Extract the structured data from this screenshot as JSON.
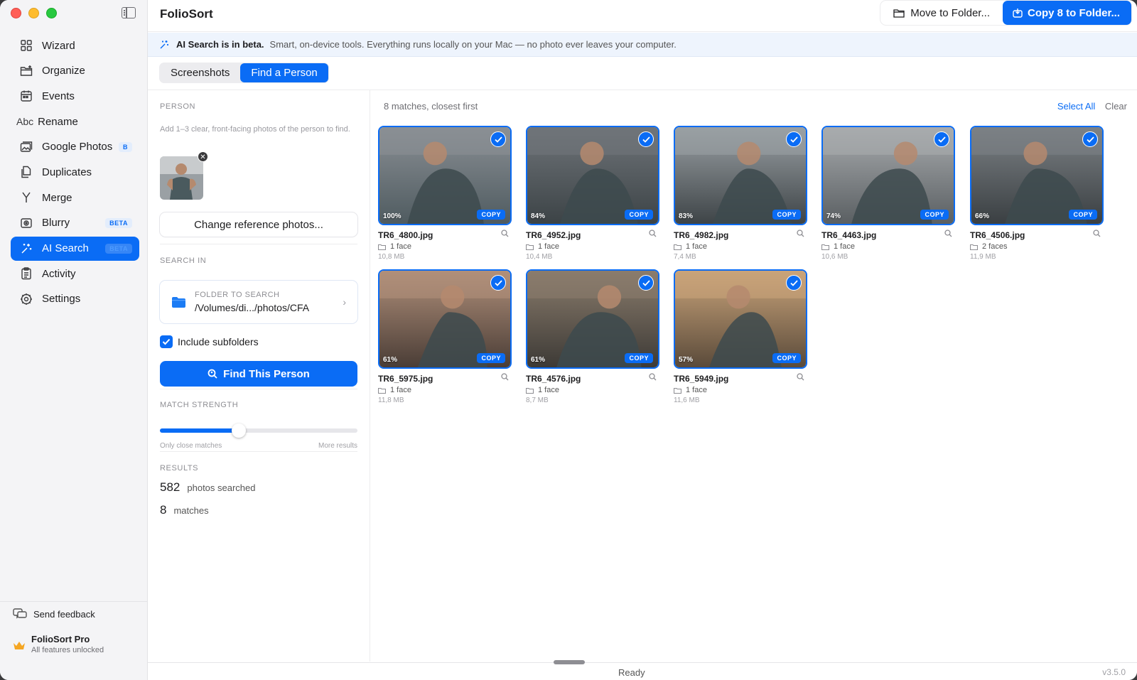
{
  "app": {
    "title": "FolioSort"
  },
  "colors": {
    "accent": "#0a6cf5"
  },
  "sidebar": {
    "items": [
      {
        "label": "Wizard",
        "icon": "grid-icon"
      },
      {
        "label": "Organize",
        "icon": "folder-plus-icon"
      },
      {
        "label": "Events",
        "icon": "calendar-icon"
      },
      {
        "label": "Rename",
        "icon": "abc-text-icon",
        "icon_text": "Abc"
      },
      {
        "label": "Google Photos",
        "icon": "photos-icon",
        "badge": "B"
      },
      {
        "label": "Duplicates",
        "icon": "duplicate-icon"
      },
      {
        "label": "Merge",
        "icon": "merge-icon"
      },
      {
        "label": "Blurry",
        "icon": "blur-icon",
        "badge": "BETA"
      },
      {
        "label": "AI Search",
        "icon": "sparkle-icon",
        "badge": "BETA",
        "active": true
      },
      {
        "label": "Activity",
        "icon": "clipboard-icon"
      },
      {
        "label": "Settings",
        "icon": "gear-icon"
      }
    ],
    "feedback": "Send feedback",
    "pro_title": "FolioSort Pro",
    "pro_sub": "All features unlocked"
  },
  "toolbar": {
    "move_label": "Move to Folder...",
    "copy_label": "Copy 8 to Folder..."
  },
  "banner": {
    "title": "AI Search is in beta.",
    "text": "Smart, on-device tools. Everything runs locally on your Mac — no photo ever leaves your computer."
  },
  "tabs": [
    {
      "label": "Screenshots",
      "active": false
    },
    {
      "label": "Find a Person",
      "active": true
    }
  ],
  "panel": {
    "person_label": "PERSON",
    "person_hint": "Add 1–3 clear, front-facing photos of the person to find.",
    "remove_glyph": "✕",
    "change_label": "Change reference photos...",
    "search_in_label": "SEARCH IN",
    "folder_label": "FOLDER TO SEARCH",
    "folder_path": "/Volumes/di.../photos/CFA",
    "include_subfolders": "Include subfolders",
    "include_subfolders_checked": true,
    "find_label": "Find This Person",
    "match_label": "MATCH STRENGTH",
    "match_value": 0.4,
    "match_left": "Only close matches",
    "match_right": "More results",
    "results_label": "RESULTS",
    "searched_count": "582",
    "searched_label": "photos searched",
    "matches_count": "8",
    "matches_label": "matches"
  },
  "grid": {
    "summary": "8 matches, closest first",
    "select_all": "Select All",
    "clear": "Clear",
    "copy_badge": "COPY",
    "items": [
      {
        "name": "TR6_4800.jpg",
        "match": "100%",
        "faces": "1 face",
        "size": "10,8 MB",
        "tone": [
          "#8a8f94",
          "#4f5b60"
        ]
      },
      {
        "name": "TR6_4952.jpg",
        "match": "84%",
        "faces": "1 face",
        "size": "10,4 MB",
        "tone": [
          "#6f7479",
          "#3c4346"
        ]
      },
      {
        "name": "TR6_4982.jpg",
        "match": "83%",
        "faces": "1 face",
        "size": "7,4 MB",
        "tone": [
          "#9aa0a4",
          "#3e4447"
        ]
      },
      {
        "name": "TR6_4463.jpg",
        "match": "74%",
        "faces": "1 face",
        "size": "10,6 MB",
        "tone": [
          "#a8abae",
          "#5a5f62"
        ]
      },
      {
        "name": "TR6_4506.jpg",
        "match": "66%",
        "faces": "2 faces",
        "size": "11,9 MB",
        "tone": [
          "#7c8185",
          "#3a3f42"
        ]
      },
      {
        "name": "TR6_5975.jpg",
        "match": "61%",
        "faces": "1 face",
        "size": "11,8 MB",
        "tone": [
          "#b08f7a",
          "#4a3d36"
        ]
      },
      {
        "name": "TR6_4576.jpg",
        "match": "61%",
        "faces": "1 face",
        "size": "8,7 MB",
        "tone": [
          "#8a7c6c",
          "#3d3a36"
        ]
      },
      {
        "name": "TR6_5949.jpg",
        "match": "57%",
        "faces": "1 face",
        "size": "11,6 MB",
        "tone": [
          "#c9a47a",
          "#5a4a3a"
        ]
      }
    ]
  },
  "status": {
    "text": "Ready",
    "version": "v3.5.0"
  }
}
